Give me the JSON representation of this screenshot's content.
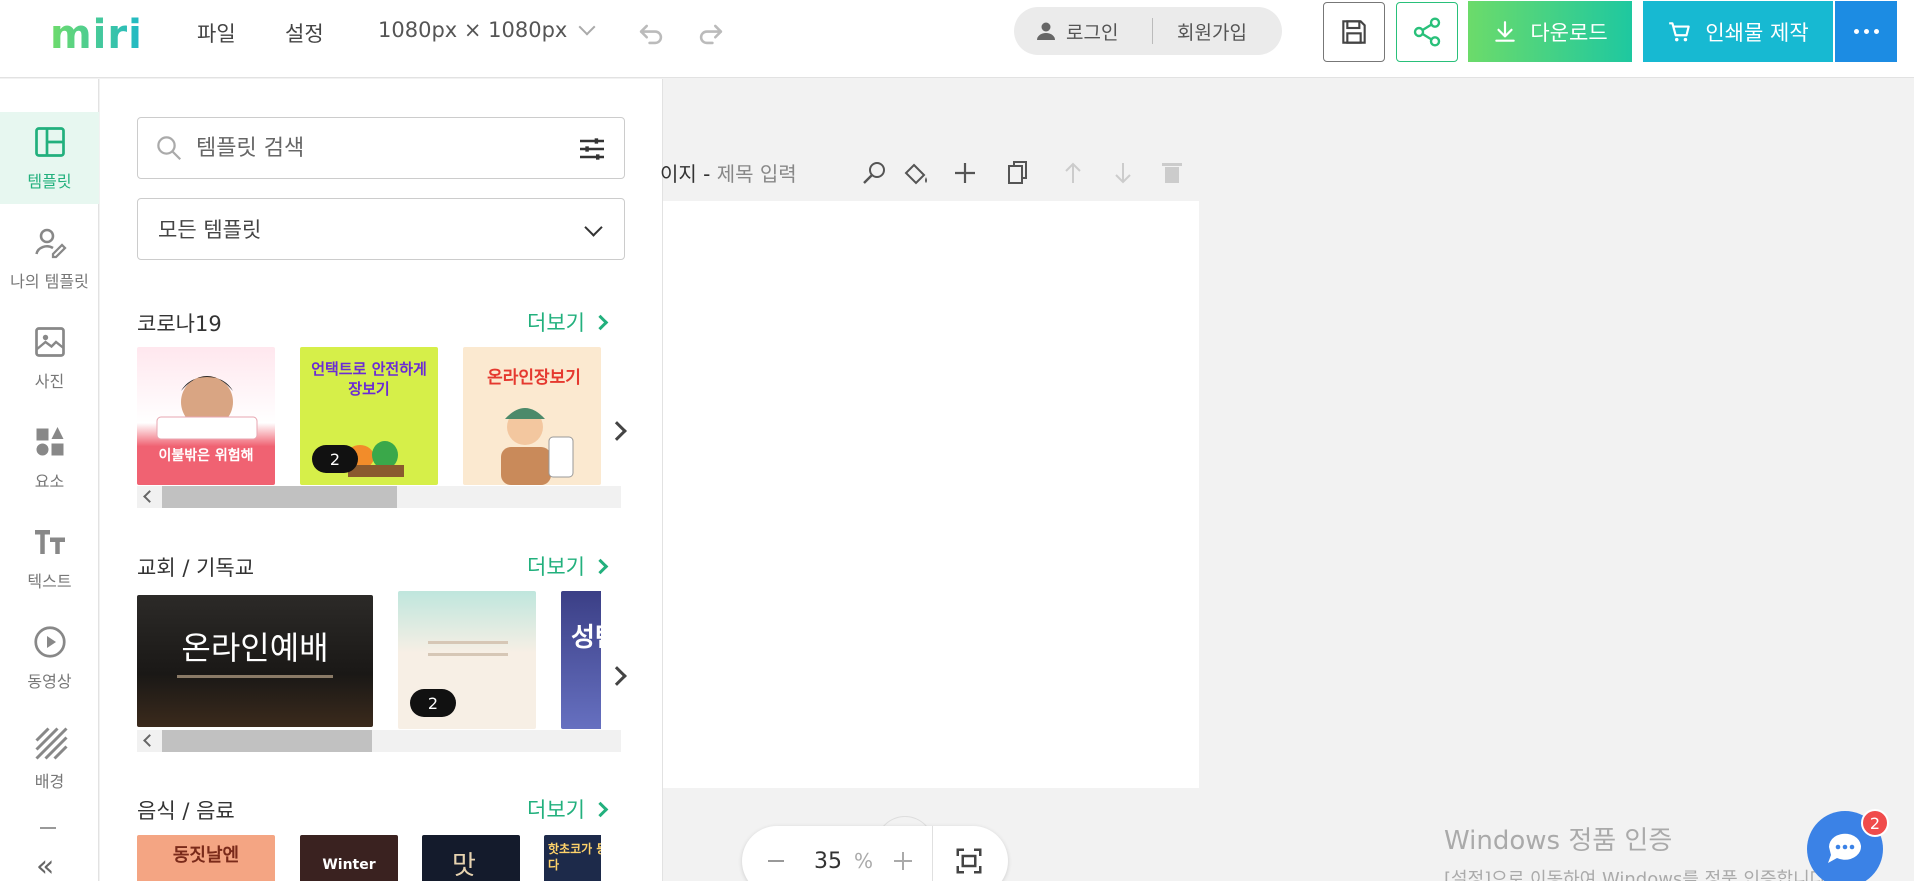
{
  "app": {
    "logo": "miri",
    "menu": {
      "file": "파일",
      "settings": "설정"
    },
    "canvas_size": "1080px × 1080px",
    "auth": {
      "login": "로그인",
      "signup": "회원가입"
    },
    "buttons": {
      "download": "다운로드",
      "print": "인쇄물 제작"
    },
    "colors": {
      "accent_green": "#22b07d",
      "download": "#4fd184",
      "print": "#17b9d2",
      "more": "#1c8ce3"
    }
  },
  "leftnav": {
    "items": [
      {
        "label": "템플릿",
        "icon": "layout-icon",
        "active": true
      },
      {
        "label": "나의 템플릿",
        "icon": "user-edit-icon",
        "active": false
      },
      {
        "label": "사진",
        "icon": "image-icon",
        "active": false
      },
      {
        "label": "요소",
        "icon": "shapes-icon",
        "active": false
      },
      {
        "label": "텍스트",
        "icon": "text-icon",
        "active": false
      },
      {
        "label": "동영상",
        "icon": "play-icon",
        "active": false
      },
      {
        "label": "배경",
        "icon": "hatch-icon",
        "active": false
      }
    ],
    "collapse": "«"
  },
  "panel": {
    "search_placeholder": "템플릿 검색",
    "category_select": "모든 템플릿",
    "more_label": "더보기",
    "sections": [
      {
        "title": "코로나19",
        "thumbs": [
          {
            "text": "이불밖은 위험해",
            "count": ""
          },
          {
            "text": "언택트로 안전하게 장보기",
            "count": "2"
          },
          {
            "text": "온라인장보기",
            "count": ""
          }
        ]
      },
      {
        "title": "교회 / 기독교",
        "thumbs": [
          {
            "text": "온라인예배",
            "count": ""
          },
          {
            "text": "",
            "count": "2"
          },
          {
            "text": "성탄",
            "count": ""
          }
        ]
      },
      {
        "title": "음식 / 음료",
        "thumbs": [
          {
            "text": "동짓날엔",
            "count": ""
          },
          {
            "text": "Winter",
            "count": ""
          },
          {
            "text": "맛",
            "count": ""
          },
          {
            "text": "핫초코가 등장했다",
            "count": ""
          }
        ]
      }
    ]
  },
  "canvas": {
    "page_label_prefix": "이지 -",
    "page_title_placeholder": "제목 입력",
    "zoom_value": "35",
    "zoom_unit": "%"
  },
  "watermark": {
    "line1": "Windows 정품 인증",
    "line2": "[설정]으로 이동하여 Windows를 정품 인증합니다."
  },
  "chat": {
    "badge": "2"
  }
}
